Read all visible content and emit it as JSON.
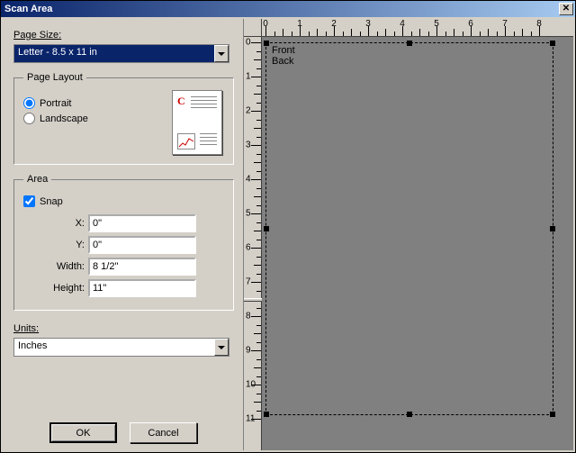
{
  "window": {
    "title": "Scan Area"
  },
  "page_size": {
    "label": "Page Size:",
    "selected": "Letter - 8.5 x 11 in"
  },
  "page_layout": {
    "legend": "Page Layout",
    "portrait": "Portrait",
    "landscape": "Landscape",
    "orientation": "portrait"
  },
  "area": {
    "legend": "Area",
    "snap_label": "Snap",
    "snap": true,
    "x_label": "X:",
    "y_label": "Y:",
    "width_label": "Width:",
    "height_label": "Height:",
    "x": "0\"",
    "y": "0\"",
    "width": "8 1/2\"",
    "height": "11\""
  },
  "units": {
    "label": "Units:",
    "selected": "Inches"
  },
  "buttons": {
    "ok": "OK",
    "cancel": "Cancel"
  },
  "preview": {
    "front": "Front",
    "back": "Back",
    "ruler_max_h": 8,
    "ruler_max_v": 11
  }
}
